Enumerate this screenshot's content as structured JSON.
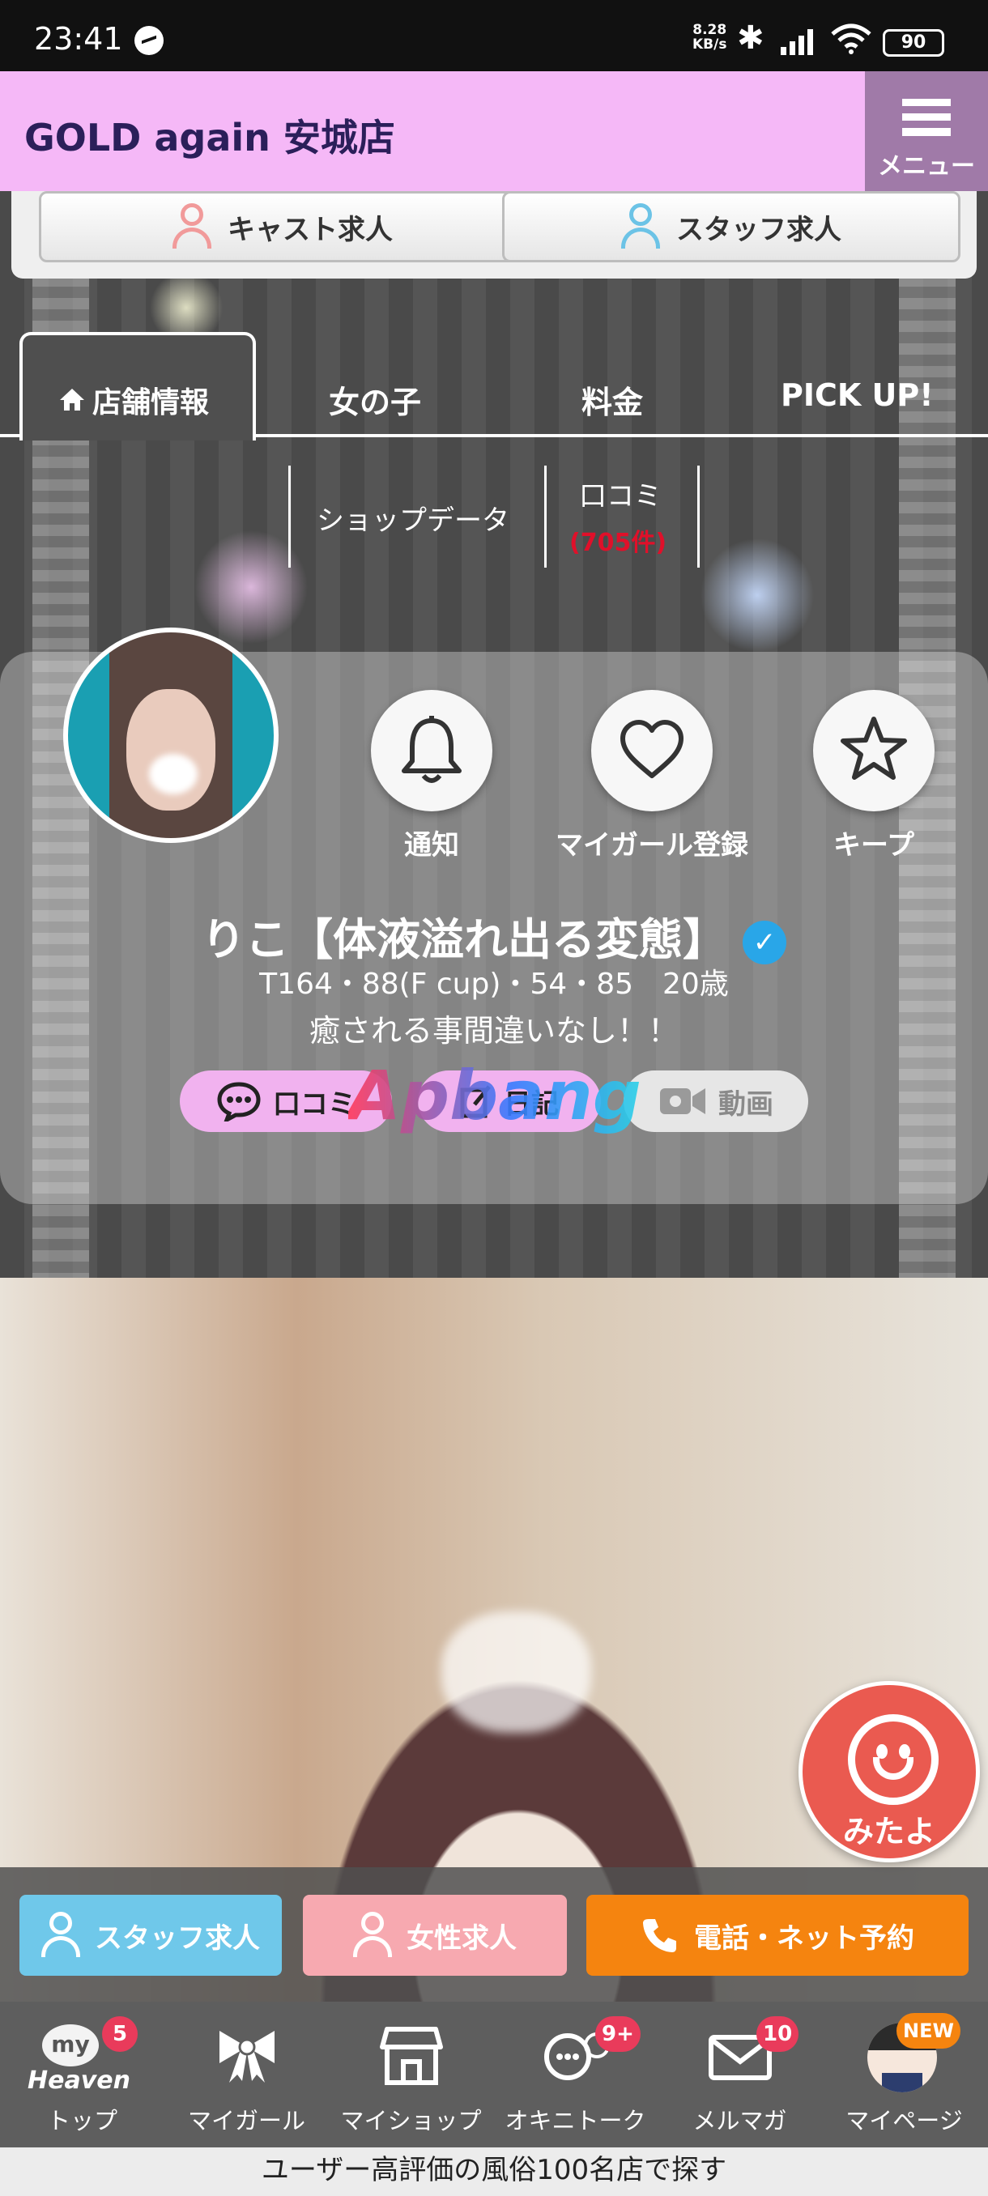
{
  "status_bar": {
    "time": "23:41",
    "net_speed_value": "8.28",
    "net_speed_unit": "KB/s",
    "battery": "90"
  },
  "header": {
    "title": "GOLD again 安城店",
    "menu_label": "メニュー"
  },
  "recruit": {
    "cast": "キャスト求人",
    "staff": "スタッフ求人"
  },
  "tabs": [
    {
      "label": "店舗情報"
    },
    {
      "label": "女の子"
    },
    {
      "label": "料金"
    },
    {
      "label": "PICK UP!"
    }
  ],
  "subnav": {
    "shop_data": "ショップデータ",
    "reviews": "口コミ",
    "reviews_count": "(705件)"
  },
  "profile": {
    "actions": {
      "notify": "通知",
      "mygirl": "マイガール登録",
      "keep": "キープ"
    },
    "name": "りこ【体液溢れ出る変態】",
    "stats": "T164・88(F cup)・54・85　20歳",
    "catchphrase": "癒される事間違いなし！！",
    "pills": {
      "review": "口コミ",
      "diary": "日記",
      "video": "動画"
    }
  },
  "watermark": "Apbang",
  "mitayo": {
    "label": "みたよ"
  },
  "action_bar": {
    "staff": "スタッフ求人",
    "female": "女性求人",
    "call": "電話・ネット予約"
  },
  "bottom_nav": [
    {
      "label": "トップ",
      "logo_top": "my",
      "logo_bottom": "Heaven",
      "badge": "5"
    },
    {
      "label": "マイガール"
    },
    {
      "label": "マイショップ"
    },
    {
      "label": "オキニトーク",
      "badge": "9+"
    },
    {
      "label": "メルマガ",
      "badge": "10"
    },
    {
      "label": "マイページ",
      "badge": "NEW"
    }
  ],
  "footer": {
    "text": "ユーザー高評価の風俗100名店で探す"
  },
  "colors": {
    "header_bg": "#f5b8f7",
    "menu_bg": "#a07aa8",
    "staff_btn": "#6fc8ea",
    "female_btn": "#f7a9b0",
    "call_btn": "#f5840f",
    "pill_pink": "#f1b2ef",
    "badge": "#e93b5b"
  }
}
